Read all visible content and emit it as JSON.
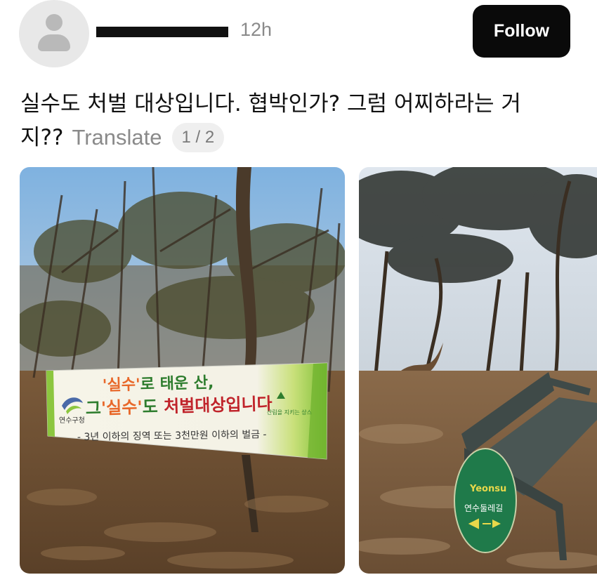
{
  "header": {
    "time": "12h",
    "follow_label": "Follow"
  },
  "post": {
    "text_line1": "실수도 처벌 대상입니다. 협박인가? 그럼 어찌하라는 거",
    "text_line2": "지??",
    "translate_label": "Translate",
    "page_indicator": "1 / 2"
  },
  "photo1": {
    "banner": {
      "line1_quote": "'실수'",
      "line1_rest": "로 태운 산,",
      "line2_a": "그",
      "line2_quote": "'실수'",
      "line2_b": "도",
      "line2_rest": " 처벌대상입니다",
      "line3": "- 3년 이하의 징역 또는 3천만원 이하의 벌금 -",
      "left_logo_text": "연수구청",
      "right_logo_text": "산림을 지키는 상스"
    }
  },
  "photo2": {
    "sign_brand": "Yeonsu",
    "sign_label": "연수둘레길"
  },
  "colors": {
    "follow_bg": "#0a0a0a",
    "time_gray": "#8a8a8a",
    "banner_orange": "#e8682a",
    "banner_red": "#c0242b",
    "banner_green": "#8cc63f",
    "sign_green": "#1f7a4a"
  }
}
